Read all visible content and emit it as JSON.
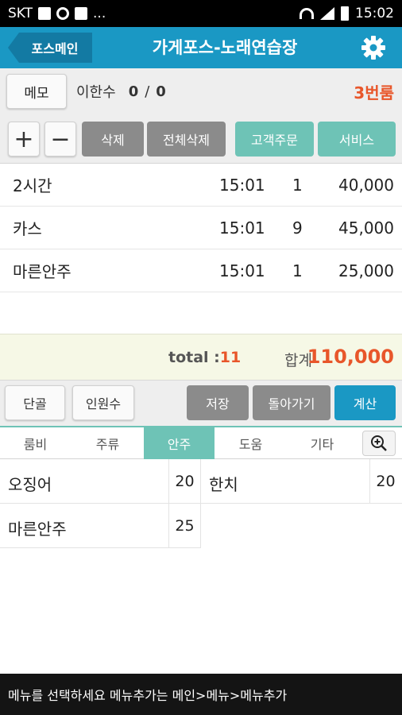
{
  "status_bar": {
    "carrier": "SKT",
    "more": "...",
    "time": "15:02"
  },
  "header": {
    "back_label": "포스메인",
    "title": "가게포스-노래연습장",
    "settings_icon": "gear-icon"
  },
  "info": {
    "memo_label": "메모",
    "customer": "이한수",
    "count_a": "0",
    "count_sep": "/",
    "count_b": "0",
    "room": "3번룸"
  },
  "actions": {
    "plus": "+",
    "minus": "−",
    "delete": "삭제",
    "delete_all": "전체삭제",
    "customer_order": "고객주문",
    "service": "서비스"
  },
  "orders": [
    {
      "name": "2시간",
      "time": "15:01",
      "qty": "1",
      "price": "40,000"
    },
    {
      "name": "카스",
      "time": "15:01",
      "qty": "9",
      "price": "45,000"
    },
    {
      "name": "마른안주",
      "time": "15:01",
      "qty": "1",
      "price": "25,000"
    }
  ],
  "totals": {
    "total_label": "total :",
    "total_count": "11",
    "sum_label": "합계",
    "sum_value": "110,000"
  },
  "bottom": {
    "regular": "단골",
    "people": "인원수",
    "save": "저장",
    "back": "돌아가기",
    "checkout": "계산"
  },
  "tabs": [
    "룸비",
    "주류",
    "안주",
    "도움",
    "기타"
  ],
  "active_tab": "안주",
  "menu_items": [
    {
      "name": "오징어",
      "price": "20"
    },
    {
      "name": "한치",
      "price": "20"
    },
    {
      "name": "마른안주",
      "price": "25"
    }
  ],
  "footer": {
    "message": "메뉴를 선택하세요 메뉴추가는 메인>메뉴>메뉴추가"
  },
  "colors": {
    "header": "#1a98c4",
    "accent_orange": "#e8562a",
    "teal": "#6ec3b6",
    "gray_button": "#8b8b8b"
  }
}
